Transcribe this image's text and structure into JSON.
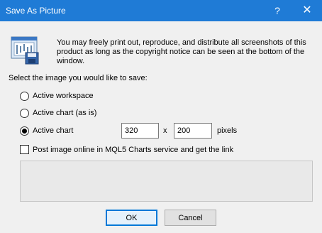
{
  "window": {
    "title": "Save As Picture",
    "help_glyph": "?",
    "close_glyph": "✕"
  },
  "notice_text": "You may freely print out, reproduce, and distribute all screenshots of this product as long as the copyright notice can be seen at the bottom of the window.",
  "select_label": "Select the image you would like to save:",
  "options": [
    {
      "label": "Active workspace",
      "checked": false
    },
    {
      "label": "Active chart (as is)",
      "checked": false
    },
    {
      "label": "Active chart",
      "checked": true
    }
  ],
  "size": {
    "width": "320",
    "separator": "x",
    "height": "200",
    "unit": "pixels"
  },
  "post_online": {
    "label": "Post image online in MQL5 Charts service and get the link",
    "checked": false
  },
  "buttons": {
    "ok": "OK",
    "cancel": "Cancel"
  },
  "colors": {
    "titlebar": "#1f7bd6",
    "dialog_bg": "#f0f0f0",
    "default_button_border": "#0078d7"
  }
}
